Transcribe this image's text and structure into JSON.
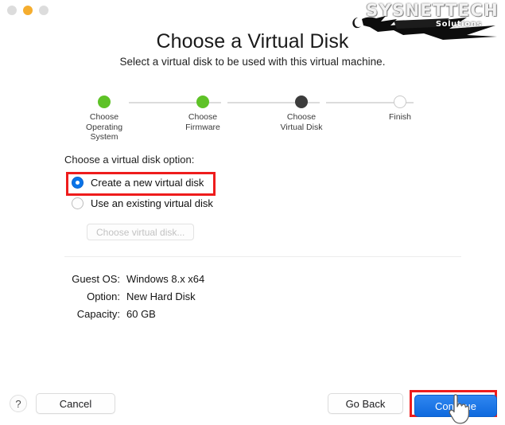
{
  "window": {
    "traffic_lights": [
      {
        "name": "close",
        "color": "#dcdcdc"
      },
      {
        "name": "minimize",
        "color": "#f5ad2e"
      },
      {
        "name": "zoom",
        "color": "#dcdcdc"
      }
    ]
  },
  "watermark": {
    "brand": "SYSNETTECH",
    "tagline": "Solutions"
  },
  "header": {
    "title": "Choose a Virtual Disk",
    "subtitle": "Select a virtual disk to be used with this virtual machine."
  },
  "stepper": {
    "steps": [
      {
        "label": "Choose\nOperating\nSystem",
        "state": "done"
      },
      {
        "label": "Choose\nFirmware",
        "state": "done"
      },
      {
        "label": "Choose\nVirtual Disk",
        "state": "current"
      },
      {
        "label": "Finish",
        "state": "todo"
      }
    ],
    "colors": {
      "done": "#5ec227",
      "current": "#3c3c3c",
      "todo_border": "#c9c9c9",
      "rail": "#dcdcdc"
    }
  },
  "options": {
    "label": "Choose a virtual disk option:",
    "create_new": "Create a new virtual disk",
    "use_existing": "Use an existing virtual disk",
    "choose_disk_button": "Choose virtual disk...",
    "selected": "create_new",
    "highlight_color": "#ee1c1c",
    "radio_accent": "#0a74e8"
  },
  "summary": {
    "rows": [
      {
        "key": "Guest OS:",
        "value": "Windows 8.x x64"
      },
      {
        "key": "Option:",
        "value": "New Hard Disk"
      },
      {
        "key": "Capacity:",
        "value": "60 GB"
      }
    ]
  },
  "footer": {
    "help": "?",
    "cancel": "Cancel",
    "go_back": "Go Back",
    "continue": "Continue",
    "continue_accent": "#1a76e8"
  }
}
